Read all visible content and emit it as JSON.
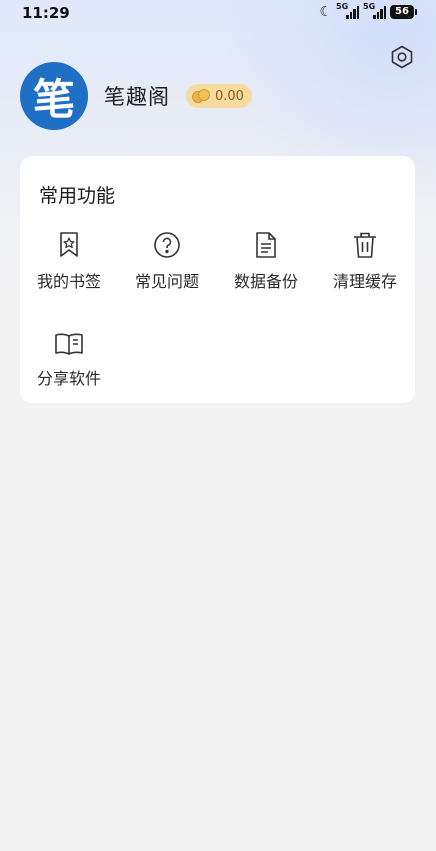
{
  "status_bar": {
    "time": "11:29",
    "network1": "5G",
    "network2": "5G",
    "battery": "56"
  },
  "profile": {
    "avatar_char": "笔",
    "app_name": "笔趣阁",
    "coin_balance": "0.00"
  },
  "common_functions": {
    "title": "常用功能",
    "items": [
      {
        "label": "我的书签",
        "icon": "bookmark-star-icon"
      },
      {
        "label": "常见问题",
        "icon": "question-circle-icon"
      },
      {
        "label": "数据备份",
        "icon": "document-icon"
      },
      {
        "label": "清理缓存",
        "icon": "trash-icon"
      },
      {
        "label": "分享软件",
        "icon": "open-book-icon"
      }
    ]
  },
  "colors": {
    "accent": "#1f6fc4",
    "badge": "#f6dba0",
    "background": "#f3f3f4"
  }
}
